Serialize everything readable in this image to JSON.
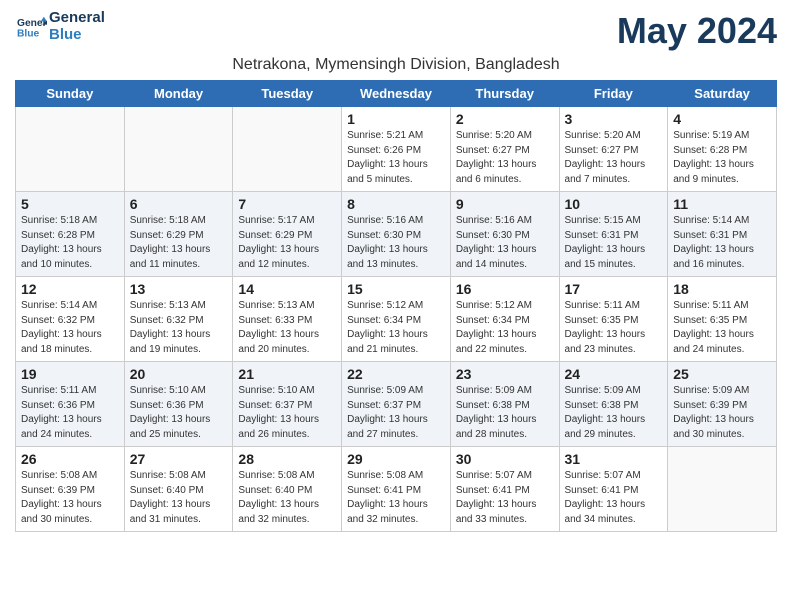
{
  "logo": {
    "line1": "General",
    "line2": "Blue"
  },
  "title": "May 2024",
  "subtitle": "Netrakona, Mymensingh Division, Bangladesh",
  "days_of_week": [
    "Sunday",
    "Monday",
    "Tuesday",
    "Wednesday",
    "Thursday",
    "Friday",
    "Saturday"
  ],
  "weeks": [
    [
      {
        "day": "",
        "info": ""
      },
      {
        "day": "",
        "info": ""
      },
      {
        "day": "",
        "info": ""
      },
      {
        "day": "1",
        "info": "Sunrise: 5:21 AM\nSunset: 6:26 PM\nDaylight: 13 hours and 5 minutes."
      },
      {
        "day": "2",
        "info": "Sunrise: 5:20 AM\nSunset: 6:27 PM\nDaylight: 13 hours and 6 minutes."
      },
      {
        "day": "3",
        "info": "Sunrise: 5:20 AM\nSunset: 6:27 PM\nDaylight: 13 hours and 7 minutes."
      },
      {
        "day": "4",
        "info": "Sunrise: 5:19 AM\nSunset: 6:28 PM\nDaylight: 13 hours and 9 minutes."
      }
    ],
    [
      {
        "day": "5",
        "info": "Sunrise: 5:18 AM\nSunset: 6:28 PM\nDaylight: 13 hours and 10 minutes."
      },
      {
        "day": "6",
        "info": "Sunrise: 5:18 AM\nSunset: 6:29 PM\nDaylight: 13 hours and 11 minutes."
      },
      {
        "day": "7",
        "info": "Sunrise: 5:17 AM\nSunset: 6:29 PM\nDaylight: 13 hours and 12 minutes."
      },
      {
        "day": "8",
        "info": "Sunrise: 5:16 AM\nSunset: 6:30 PM\nDaylight: 13 hours and 13 minutes."
      },
      {
        "day": "9",
        "info": "Sunrise: 5:16 AM\nSunset: 6:30 PM\nDaylight: 13 hours and 14 minutes."
      },
      {
        "day": "10",
        "info": "Sunrise: 5:15 AM\nSunset: 6:31 PM\nDaylight: 13 hours and 15 minutes."
      },
      {
        "day": "11",
        "info": "Sunrise: 5:14 AM\nSunset: 6:31 PM\nDaylight: 13 hours and 16 minutes."
      }
    ],
    [
      {
        "day": "12",
        "info": "Sunrise: 5:14 AM\nSunset: 6:32 PM\nDaylight: 13 hours and 18 minutes."
      },
      {
        "day": "13",
        "info": "Sunrise: 5:13 AM\nSunset: 6:32 PM\nDaylight: 13 hours and 19 minutes."
      },
      {
        "day": "14",
        "info": "Sunrise: 5:13 AM\nSunset: 6:33 PM\nDaylight: 13 hours and 20 minutes."
      },
      {
        "day": "15",
        "info": "Sunrise: 5:12 AM\nSunset: 6:34 PM\nDaylight: 13 hours and 21 minutes."
      },
      {
        "day": "16",
        "info": "Sunrise: 5:12 AM\nSunset: 6:34 PM\nDaylight: 13 hours and 22 minutes."
      },
      {
        "day": "17",
        "info": "Sunrise: 5:11 AM\nSunset: 6:35 PM\nDaylight: 13 hours and 23 minutes."
      },
      {
        "day": "18",
        "info": "Sunrise: 5:11 AM\nSunset: 6:35 PM\nDaylight: 13 hours and 24 minutes."
      }
    ],
    [
      {
        "day": "19",
        "info": "Sunrise: 5:11 AM\nSunset: 6:36 PM\nDaylight: 13 hours and 24 minutes."
      },
      {
        "day": "20",
        "info": "Sunrise: 5:10 AM\nSunset: 6:36 PM\nDaylight: 13 hours and 25 minutes."
      },
      {
        "day": "21",
        "info": "Sunrise: 5:10 AM\nSunset: 6:37 PM\nDaylight: 13 hours and 26 minutes."
      },
      {
        "day": "22",
        "info": "Sunrise: 5:09 AM\nSunset: 6:37 PM\nDaylight: 13 hours and 27 minutes."
      },
      {
        "day": "23",
        "info": "Sunrise: 5:09 AM\nSunset: 6:38 PM\nDaylight: 13 hours and 28 minutes."
      },
      {
        "day": "24",
        "info": "Sunrise: 5:09 AM\nSunset: 6:38 PM\nDaylight: 13 hours and 29 minutes."
      },
      {
        "day": "25",
        "info": "Sunrise: 5:09 AM\nSunset: 6:39 PM\nDaylight: 13 hours and 30 minutes."
      }
    ],
    [
      {
        "day": "26",
        "info": "Sunrise: 5:08 AM\nSunset: 6:39 PM\nDaylight: 13 hours and 30 minutes."
      },
      {
        "day": "27",
        "info": "Sunrise: 5:08 AM\nSunset: 6:40 PM\nDaylight: 13 hours and 31 minutes."
      },
      {
        "day": "28",
        "info": "Sunrise: 5:08 AM\nSunset: 6:40 PM\nDaylight: 13 hours and 32 minutes."
      },
      {
        "day": "29",
        "info": "Sunrise: 5:08 AM\nSunset: 6:41 PM\nDaylight: 13 hours and 32 minutes."
      },
      {
        "day": "30",
        "info": "Sunrise: 5:07 AM\nSunset: 6:41 PM\nDaylight: 13 hours and 33 minutes."
      },
      {
        "day": "31",
        "info": "Sunrise: 5:07 AM\nSunset: 6:41 PM\nDaylight: 13 hours and 34 minutes."
      },
      {
        "day": "",
        "info": ""
      }
    ]
  ]
}
